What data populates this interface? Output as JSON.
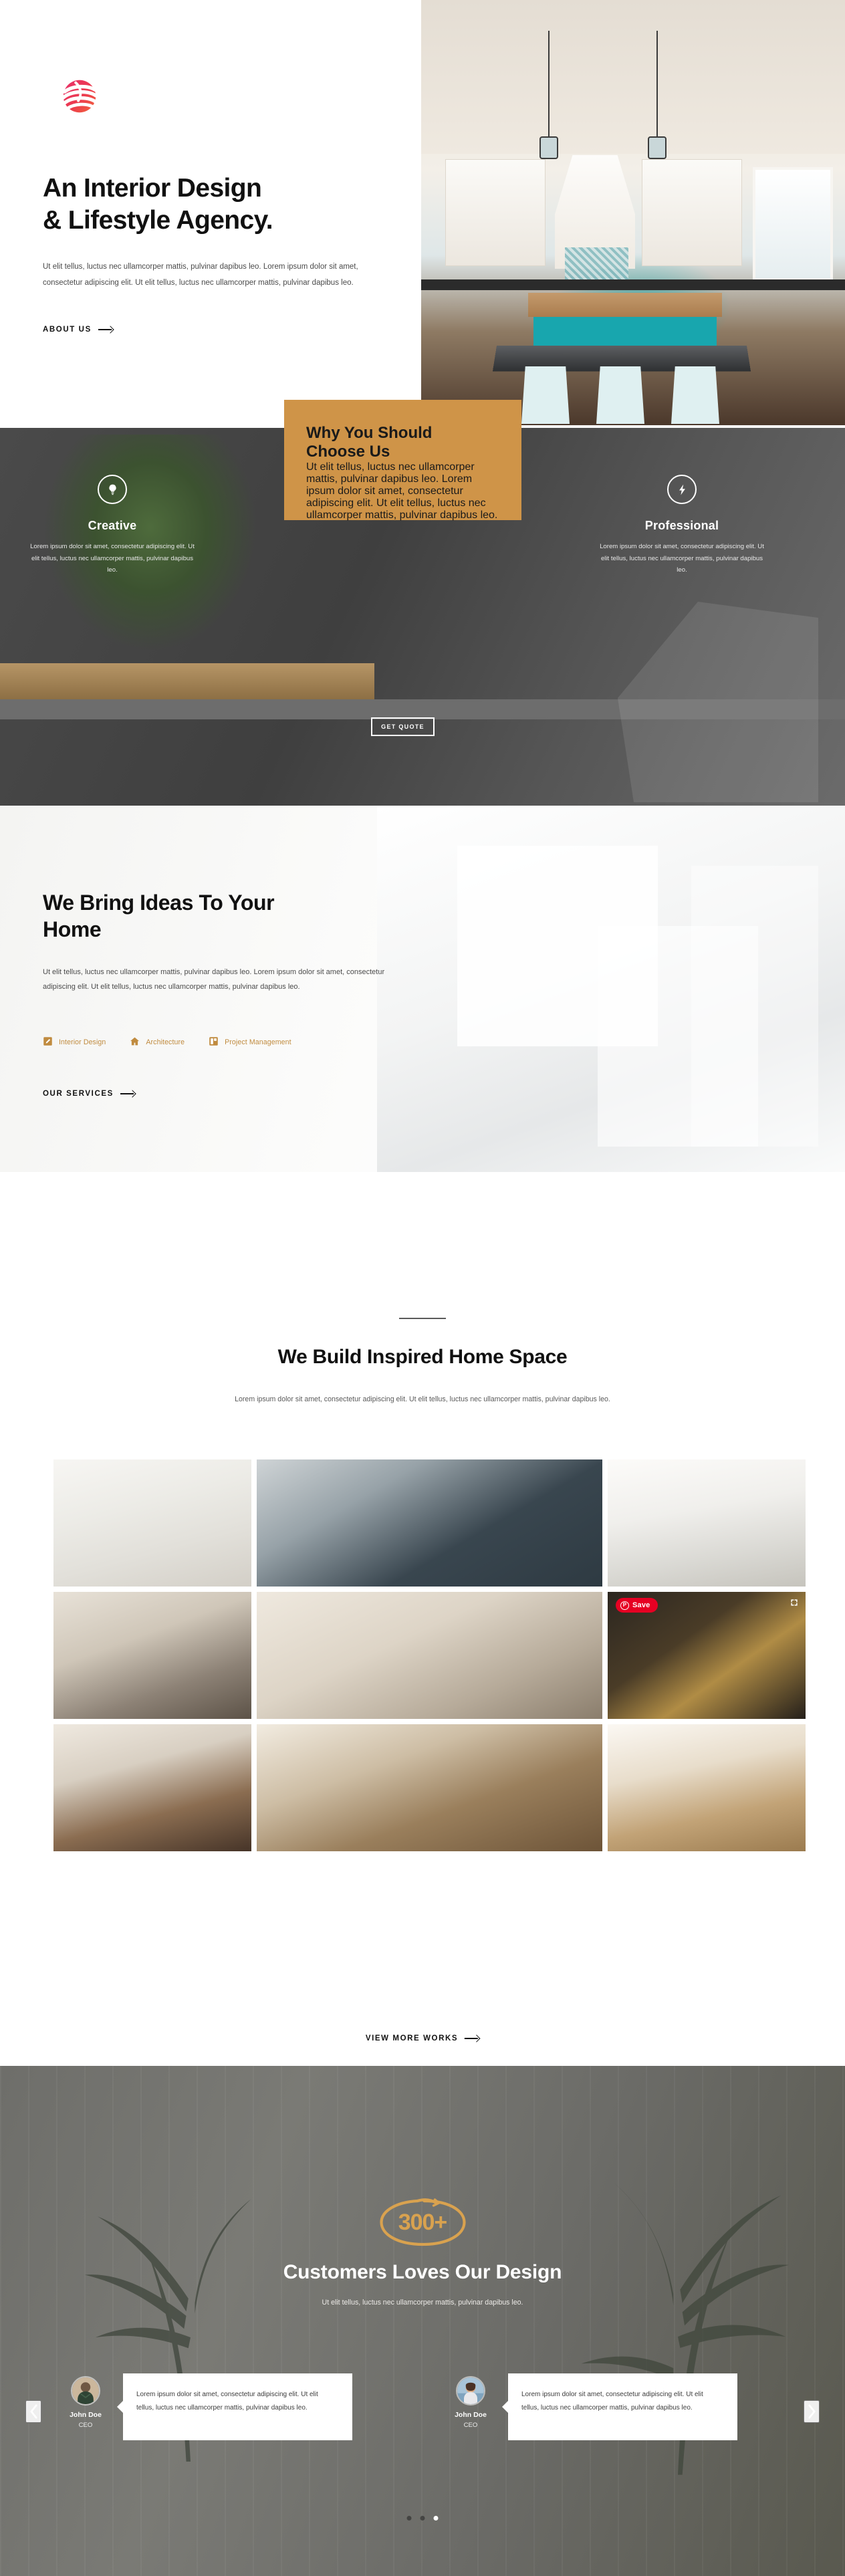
{
  "brand": {
    "logo_icon": "sphere-globe-logo"
  },
  "hero": {
    "title_line1": "An Interior Design",
    "title_line2": "& Lifestyle Agency.",
    "paragraph": "Ut elit tellus, luctus nec ullamcorper mattis, pulvinar dapibus leo. Lorem ipsum dolor sit amet, consectetur adipiscing elit. Ut elit tellus, luctus nec ullamcorper mattis, pulvinar dapibus leo.",
    "cta": "ABOUT US",
    "image_alt": "modern white kitchen with teal island and pendant lights"
  },
  "choose": {
    "heading_line1": "Why You Should",
    "heading_line2": "Choose Us",
    "paragraph": "Ut elit tellus, luctus nec ullamcorper mattis, pulvinar dapibus leo. Lorem ipsum dolor sit amet, consectetur adipiscing elit. Ut elit tellus, luctus nec ullamcorper mattis, pulvinar dapibus leo.",
    "quote_button": "GET QUOTE",
    "accent_color": "#cf9448",
    "features": [
      {
        "icon": "lightbulb-icon",
        "title": "Creative",
        "text": "Lorem ipsum dolor sit amet, consectetur adipiscing elit. Ut elit tellus, luctus nec ullamcorper mattis, pulvinar dapibus leo."
      },
      {
        "icon": "lightning-bolt-icon",
        "title": "Professional",
        "text": "Lorem ipsum dolor sit amet, consectetur adipiscing elit. Ut elit tellus, luctus nec ullamcorper mattis, pulvinar dapibus leo."
      }
    ]
  },
  "ideas": {
    "title_line1": "We Bring Ideas To Your",
    "title_line2": "Home",
    "paragraph": "Ut elit tellus, luctus nec ullamcorper mattis, pulvinar dapibus leo. Lorem ipsum dolor sit amet, consectetur adipiscing elit. Ut elit tellus, luctus nec ullamcorper mattis, pulvinar dapibus leo.",
    "tag_color": "#c08b3f",
    "tags": [
      {
        "icon": "pencil-square-icon",
        "label": "Interior Design"
      },
      {
        "icon": "home-icon",
        "label": "Architecture"
      },
      {
        "icon": "layout-grid-icon",
        "label": "Project Management"
      }
    ],
    "cta": "OUR SERVICES"
  },
  "works": {
    "title": "We Build Inspired Home Space",
    "subtitle": "Lorem ipsum dolor sit amet, consectetur adipiscing elit. Ut elit tellus, luctus nec ullamcorper mattis, pulvinar dapibus leo.",
    "cta": "VIEW MORE WORKS",
    "save_badge": "Save",
    "save_badge_color": "#e60023",
    "gallery": [
      {
        "alt": "white kitchen with cage pendant lights and marble island"
      },
      {
        "alt": "long dining room with navy wall and wood bar table"
      },
      {
        "alt": "bright white kitchen with crystal pendants and island"
      },
      {
        "alt": "living room with grey sofa and wood ceiling"
      },
      {
        "alt": "dining nook with bench seating and round table"
      },
      {
        "alt": "dark restaurant interior with brass screens and tables"
      },
      {
        "alt": "galley kitchen with exposed brick and white benchtop"
      },
      {
        "alt": "bedroom with timber feature wall and green bedspread"
      },
      {
        "alt": "small kitchen with oven, window and tan bar stools"
      }
    ]
  },
  "testimonials": {
    "count_badge": "300+",
    "title": "Customers Loves Our Design",
    "subtitle": "Ut elit tellus, luctus nec ullamcorper mattis, pulvinar dapibus leo.",
    "prev_icon": "chevron-left-icon",
    "next_icon": "chevron-right-icon",
    "dots": [
      false,
      false,
      true
    ],
    "items": [
      {
        "name": "John Doe",
        "role": "CEO",
        "quote": "Lorem ipsum dolor sit amet, consectetur adipiscing elit. Ut elit tellus, luctus nec ullamcorper mattis, pulvinar dapibus leo.",
        "avatar_alt": "bearded man in plaid shirt"
      },
      {
        "name": "John Doe",
        "role": "CEO",
        "quote": "Lorem ipsum dolor sit amet, consectetur adipiscing elit. Ut elit tellus, luctus nec ullamcorper mattis, pulvinar dapibus leo.",
        "avatar_alt": "woman by the sea holding a cup"
      }
    ]
  }
}
